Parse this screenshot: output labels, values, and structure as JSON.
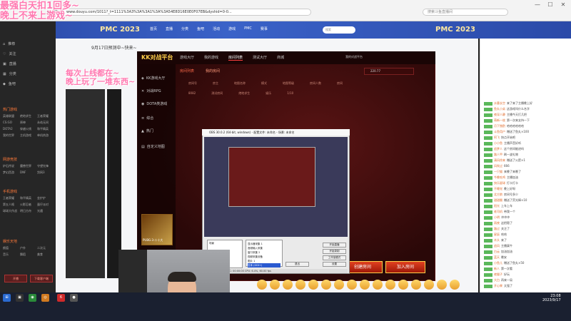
{
  "overlay": {
    "line1": "最强白天扣1回多~",
    "line2": "晚上不来上游戏~",
    "line3": "每次上线都在~",
    "line4": "晚上玩了一堆东西~"
  },
  "browser": {
    "url": "www.douyu.com/1011?_t=1111%3A3%3A%3A1%3A%3A54E8D16E0E0F07EB&dyshid=0-0...",
    "search_placeholder": "搜索斗鱼直播间",
    "back": "←",
    "forward": "→",
    "refresh": "⟳",
    "minimize": "—",
    "maximize": "☐",
    "close": "✕"
  },
  "site": {
    "nav": [
      "首页",
      "直播",
      "分类",
      "鱼吧",
      "活动",
      "游戏",
      "PMC",
      "赛事"
    ],
    "event_left": "PMC 2023",
    "event_right": "PMC 2023",
    "search_placeholder": "搜索"
  },
  "sidebar": {
    "items": [
      "推荐",
      "关注",
      "直播",
      "分类",
      "鱼吧"
    ],
    "section1": "热门游戏",
    "grid1": [
      "英雄联盟",
      "绝地求生",
      "王者荣耀",
      "CS:GO",
      "原神",
      "永劫无间",
      "DOTA2",
      "穿越火线",
      "和平精英",
      "我的世界",
      "主机游戏",
      "单机热游"
    ],
    "section2": "网游竞技",
    "grid2": [
      "炉石传说",
      "魔兽世界",
      "守望先锋",
      "梦幻西游",
      "DNF",
      "剑网3"
    ],
    "section3": "手机游戏",
    "grid3": [
      "王者荣耀",
      "和平精英",
      "金铲铲",
      "第五人格",
      "火影忍者",
      "蛋仔派对",
      "球球大作战",
      "明日方舟",
      "光遇"
    ],
    "section4": "娱乐天地",
    "grid4": [
      "颜值",
      "户外",
      "二次元",
      "音乐",
      "舞蹈",
      "美食"
    ],
    "btn_left": "开播",
    "btn_right": "下载客户端"
  },
  "stream": {
    "title": "9月17日预测中~快来~"
  },
  "kk": {
    "logo": "KK对战平台",
    "nav": [
      "游戏大厅",
      "我的游戏",
      "房间列表",
      "测试大厅",
      "商城"
    ],
    "active_nav": "房间列表",
    "user": "我的对战平台",
    "side": [
      "KK游戏大厅",
      "对战RPG",
      "DOTA类游戏",
      "综合",
      "热门",
      "自定义地图"
    ],
    "tabs": [
      "房间列表",
      "我的房间"
    ],
    "headers": [
      "房间号",
      "房间名称",
      "地图名",
      "模式",
      "人数",
      "状态"
    ],
    "rows": [
      [
        "房间号",
        "房主",
        "地图名称",
        "模式",
        "地图等级",
        "房间人数",
        "房间"
      ],
      [
        "8082",
        "测试房间",
        "绝地求生",
        "娱乐",
        "1/10"
      ]
    ],
    "search_value": "220.77",
    "btn_create": "创建房间",
    "btn_join": "加入房间",
    "poster_caption": "PUBG·3·二十大"
  },
  "obs": {
    "title": "OBS 30.0.2 (64-bit, windows) - 配置文件: 未命名 - 场景: 未命名",
    "scenes_label": "场景",
    "sources": [
      "显示器采集 1",
      "音频输入采集",
      "窗口采集 2",
      "视频采集设备",
      "图片 1",
      "文本 (GDI+)"
    ],
    "selected_source": "文本 (GDI+)",
    "buttons": [
      "开始直播",
      "开始录制",
      "工作室模式",
      "设置",
      "退出"
    ],
    "status": "LIVE: 00:00:00   REC: 00:00:00   CPU: 6.4%, 60.00 fps"
  },
  "chat": {
    "messages": [
      {
        "name": "水墨长空",
        "text": "来了来了主播晚上好"
      },
      {
        "name": "鱼丸小弟",
        "text": "这游戏叫什么名字"
      },
      {
        "name": "夜深人静",
        "text": "主播今天打几把"
      },
      {
        "name": "萌新一枚",
        "text": "第一次来支持一下"
      },
      {
        "name": "月下独酌",
        "text": "哈哈哈哈哈哈"
      },
      {
        "name": "斗鱼用户",
        "text": "赠送了鱼丸×100"
      },
      {
        "name": "阿飞",
        "text": "快点开始吧"
      },
      {
        "name": "小小鱼",
        "text": "主播声音好听"
      },
      {
        "name": "追梦人",
        "text": "这个房间能进吗"
      },
      {
        "name": "路人甲",
        "text": "刷一波礼物"
      },
      {
        "name": "清风徐来",
        "text": "赠送了火箭×1"
      },
      {
        "name": "风吹过",
        "text": "666"
      },
      {
        "name": "一只猫",
        "text": "来晚了来晚了"
      },
      {
        "name": "今晚吃鸡",
        "text": "主播加油"
      },
      {
        "name": "快乐星球",
        "text": "打卡打卡"
      },
      {
        "name": "不睡觉",
        "text": "晚上好呀"
      },
      {
        "name": "北方狼",
        "text": "房间号多少"
      },
      {
        "name": "甜甜圈",
        "text": "赠送了荧光棒×10"
      },
      {
        "name": "阳光",
        "text": "上车上车"
      },
      {
        "name": "老司机",
        "text": "带我一个"
      },
      {
        "name": "小明",
        "text": "冲冲冲"
      },
      {
        "name": "雨夜",
        "text": "这把稳了"
      },
      {
        "name": "路过",
        "text": "关注了"
      },
      {
        "name": "星辰",
        "text": "哈哈"
      },
      {
        "name": "木头",
        "text": "来了"
      },
      {
        "name": "追风",
        "text": "主播真牛"
      },
      {
        "name": "白云",
        "text": "加油加油"
      },
      {
        "name": "蓝天",
        "text": "晚安"
      },
      {
        "name": "小鱼儿",
        "text": "赠送了鱼丸×50"
      },
      {
        "name": "新人",
        "text": "第一次看"
      },
      {
        "name": "夜猫子",
        "text": "好玩"
      },
      {
        "name": "大白",
        "text": "再来一局"
      },
      {
        "name": "开心果",
        "text": "太强了"
      }
    ]
  },
  "taskbar": {
    "time": "23:08",
    "date": "2023/9/17"
  }
}
